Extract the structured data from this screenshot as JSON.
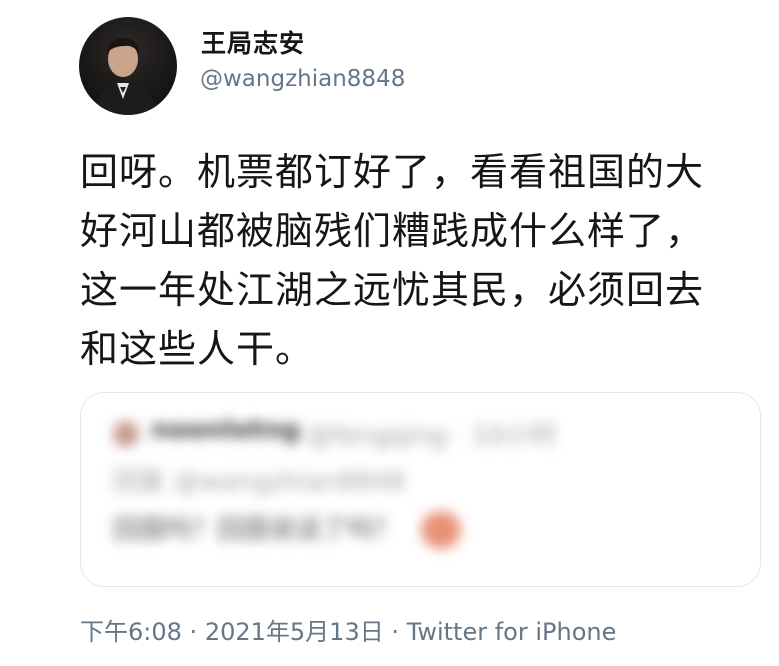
{
  "tweet": {
    "author": {
      "display_name": "王局志安",
      "handle": "@wangzhian8848",
      "avatar_icon": "profile-photo"
    },
    "text": "回呀。机票都订好了，看看祖国的大好河山都被脑残们糟践成什么样了，这一年处江湖之远忧其民，必须回去和这些人干。",
    "quoted_tweet": {
      "name": "noonlotng",
      "handle_meta": "@fengqing · 10小时",
      "handle_2": "回复 @wangzhian8848",
      "text": "回国吗？回国说话了吗？"
    },
    "time": "下午6:08",
    "separator": "·",
    "date": "2021年5月13日",
    "source": "Twitter for iPhone"
  }
}
